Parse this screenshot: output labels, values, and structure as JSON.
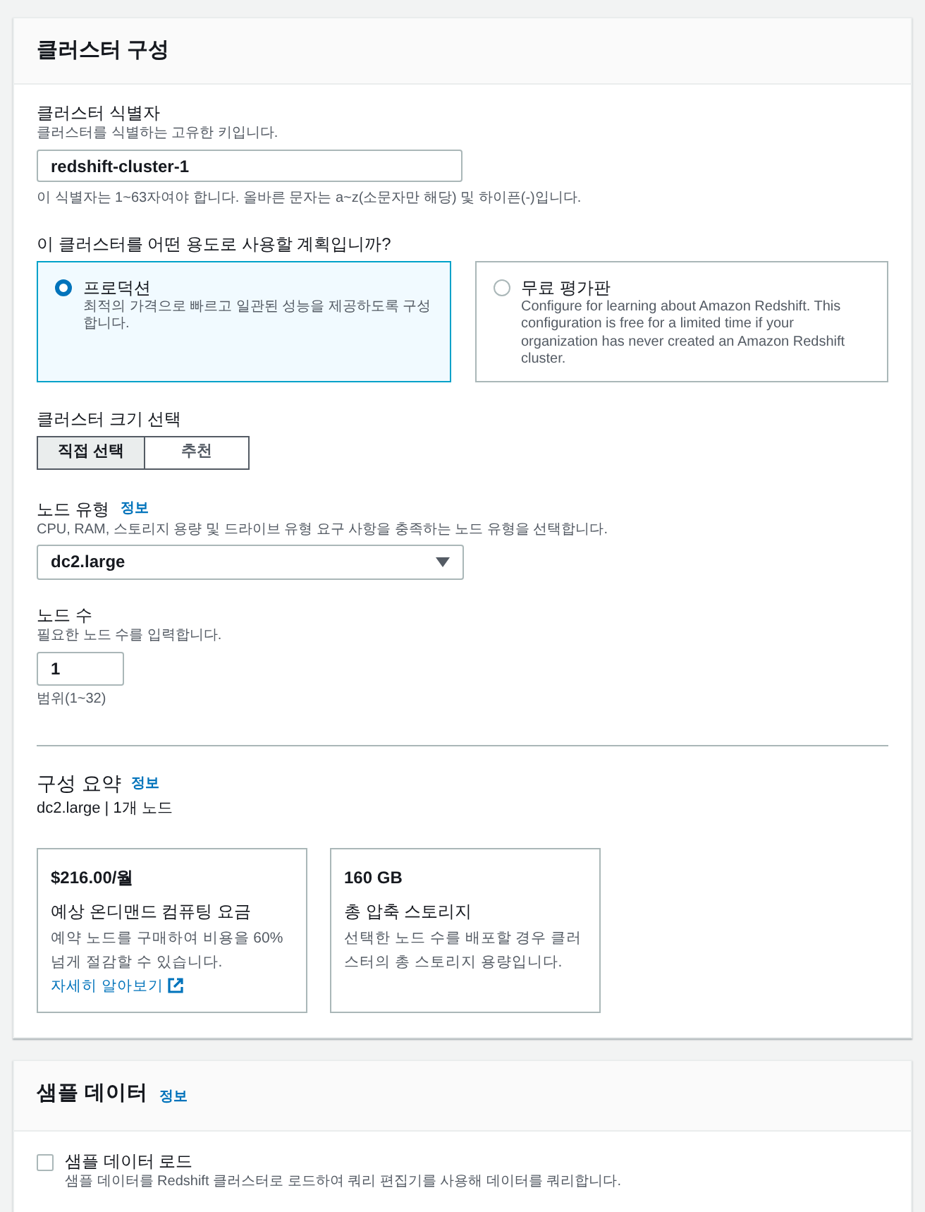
{
  "panel": {
    "title": "클러스터 구성"
  },
  "identifier": {
    "label": "클러스터 식별자",
    "description": "클러스터를 식별하는 고유한 키입니다.",
    "value": "redshift-cluster-1",
    "hint": "이 식별자는 1~63자여야 합니다. 올바른 문자는 a~z(소문자만 해당) 및 하이픈(-)입니다."
  },
  "usage": {
    "question": "이 클러스터를 어떤 용도로 사용할 계획입니까?",
    "options": [
      {
        "title": "프로덕션",
        "description": "최적의 가격으로 빠르고 일관된 성능을 제공하도록 구성합니다.",
        "selected": true
      },
      {
        "title": "무료 평가판",
        "description": "Configure for learning about Amazon Redshift. This configuration is free for a limited time if your organization has never created an Amazon Redshift cluster.",
        "selected": false
      }
    ]
  },
  "size": {
    "label": "클러스터 크기 선택",
    "options": [
      {
        "label": "직접 선택",
        "selected": true
      },
      {
        "label": "추천",
        "selected": false
      }
    ]
  },
  "node_type": {
    "label": "노드 유형",
    "info_link": "정보",
    "description": "CPU, RAM, 스토리지 용량 및 드라이브 유형 요구 사항을 충족하는 노드 유형을 선택합니다.",
    "value": "dc2.large"
  },
  "node_count": {
    "label": "노드 수",
    "description": "필요한 노드 수를 입력합니다.",
    "value": "1",
    "hint": "범위(1~32)"
  },
  "summary": {
    "title": "구성 요약",
    "info_link": "정보",
    "subtitle": "dc2.large | 1개 노드",
    "cards": [
      {
        "value": "$216.00/월",
        "title": "예상 온디맨드 컴퓨팅 요금",
        "description": "예약 노드를 구매하여 비용을 60% 넘게 절감할 수 있습니다.",
        "link": "자세히 알아보기"
      },
      {
        "value": "160 GB",
        "title": "총 압축 스토리지",
        "description": "선택한 노드 수를 배포할 경우 클러스터의 총 스토리지 용량입니다."
      }
    ]
  },
  "sample_data": {
    "title": "샘플 데이터",
    "info_link": "정보",
    "checkbox": {
      "label": "샘플 데이터 로드",
      "description": "샘플 데이터를 Redshift 클러스터로 로드하여 쿼리 편집기를 사용해 데이터를 쿼리합니다.",
      "checked": false
    }
  }
}
